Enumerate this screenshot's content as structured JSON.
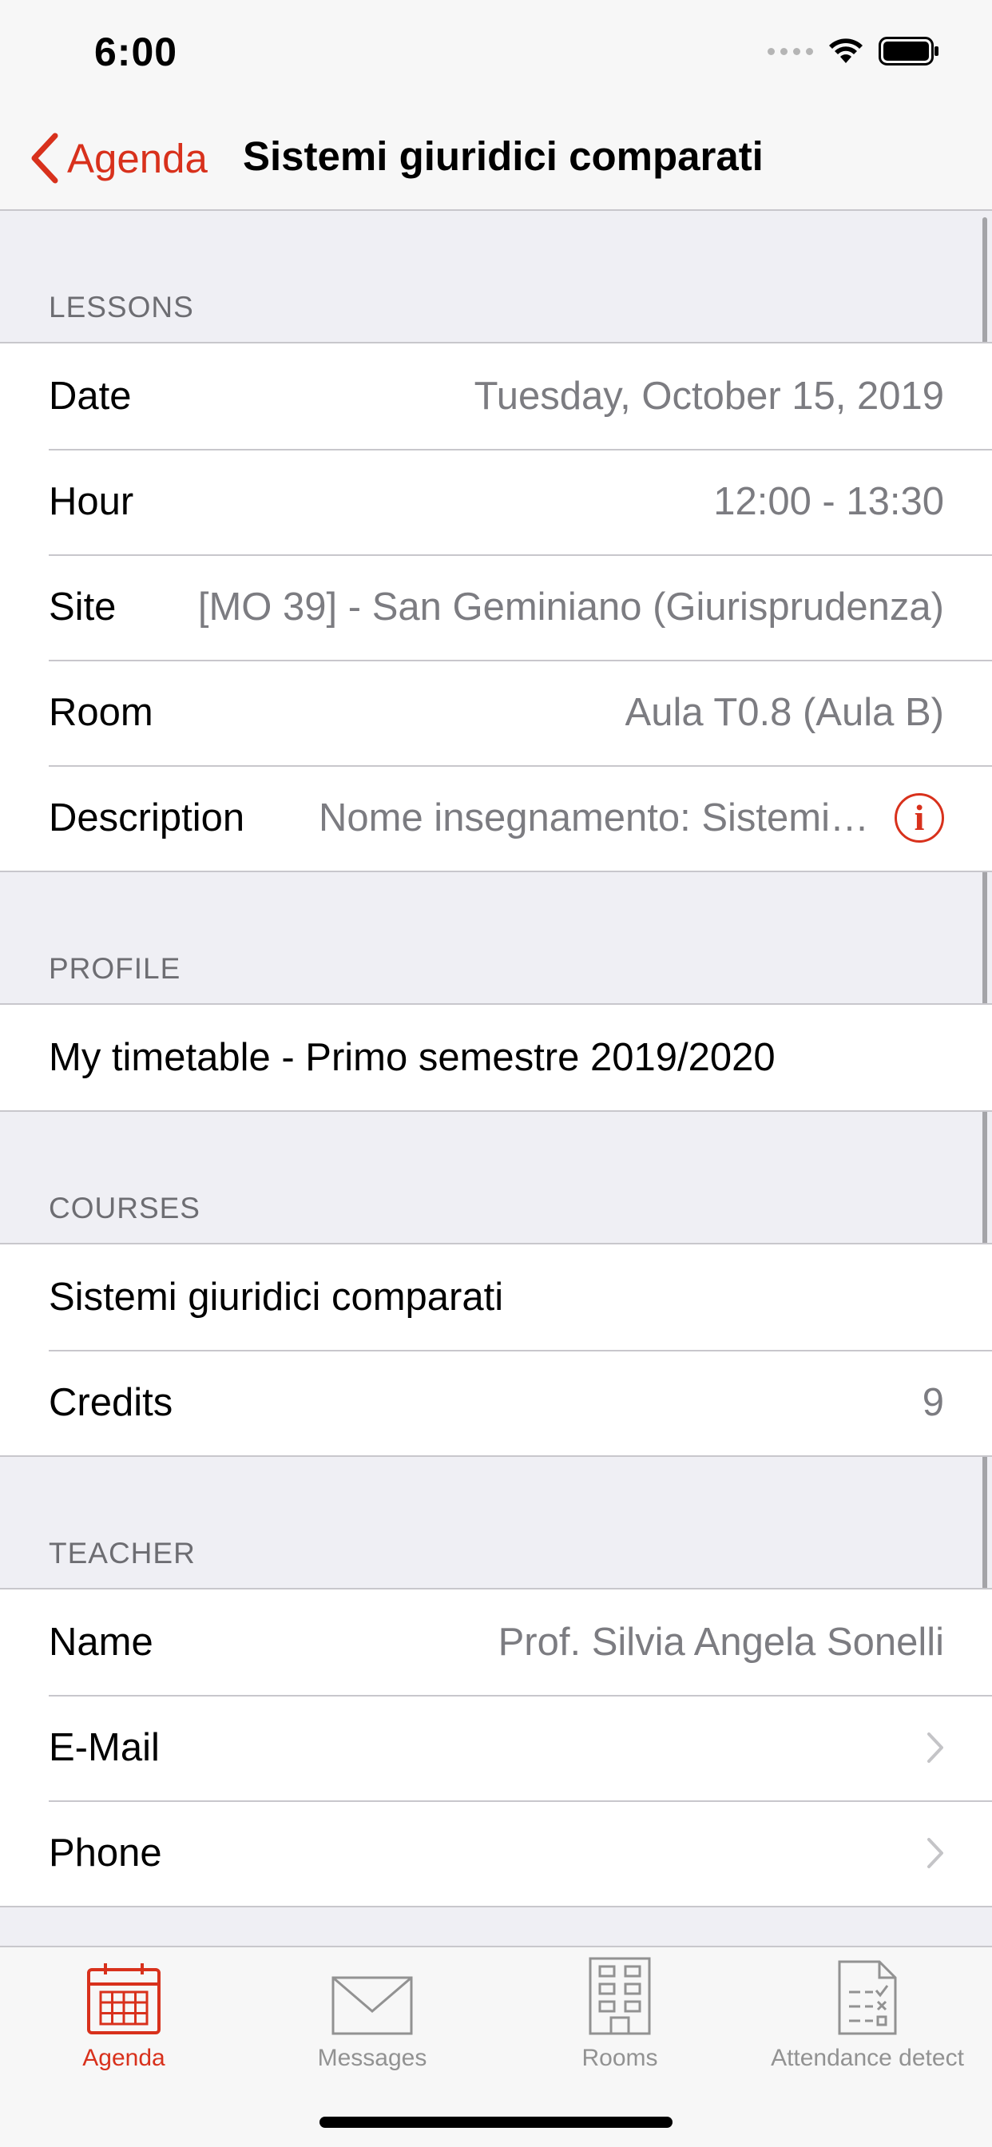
{
  "status_bar": {
    "time": "6:00"
  },
  "nav": {
    "back_label": "Agenda",
    "title": "Sistemi giuridici comparati"
  },
  "lessons": {
    "header": "LESSONS",
    "rows": [
      {
        "label": "Date",
        "value": "Tuesday, October 15, 2019"
      },
      {
        "label": "Hour",
        "value": "12:00 - 13:30"
      },
      {
        "label": "Site",
        "value": "[MO 39] - San Geminiano (Giurisprudenza)"
      },
      {
        "label": "Room",
        "value": "Aula T0.8 (Aula B)"
      },
      {
        "label": "Description",
        "value": "Nome insegnamento: Sistemi…"
      }
    ]
  },
  "profile": {
    "header": "PROFILE",
    "value": "My timetable - Primo semestre 2019/2020"
  },
  "courses": {
    "header": "COURSES",
    "course_name": "Sistemi giuridici comparati",
    "credits_label": "Credits",
    "credits_value": "9"
  },
  "teacher": {
    "header": "TEACHER",
    "name_label": "Name",
    "name_value": "Prof. Silvia Angela Sonelli",
    "email_label": "E-Mail",
    "phone_label": "Phone"
  },
  "tabs": [
    {
      "label": "Agenda",
      "icon": "calendar-icon",
      "active": true
    },
    {
      "label": "Messages",
      "icon": "envelope-icon",
      "active": false
    },
    {
      "label": "Rooms",
      "icon": "building-icon",
      "active": false
    },
    {
      "label": "Attendance detect",
      "icon": "checklist-document-icon",
      "active": false
    }
  ],
  "colors": {
    "accent": "#d8311c",
    "background": "#efeff4",
    "secondary_text": "#7c7c81"
  }
}
